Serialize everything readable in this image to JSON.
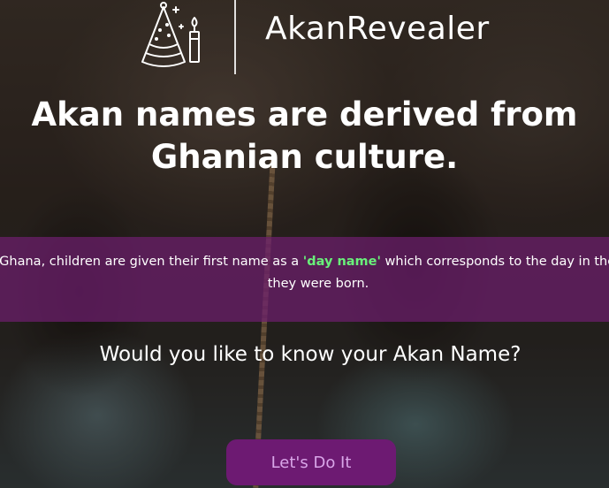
{
  "header": {
    "brand": "AkanRevealer",
    "logo_icon": "party-hat-candle-icon"
  },
  "hero": {
    "headline": "Akan names are derived from Ghanian culture.",
    "info_before": "In Ghana, children are given their first name as a ",
    "info_highlight": "'day name'",
    "info_after": " which corresponds to the day in the week they were born.",
    "question": "Would you like to know your Akan Name?",
    "cta_label": "Let's Do It"
  },
  "colors": {
    "band": "#6e1e6e",
    "highlight": "#69f07a",
    "cta_bg": "#6d1a72",
    "cta_text": "#d9a6e8"
  }
}
